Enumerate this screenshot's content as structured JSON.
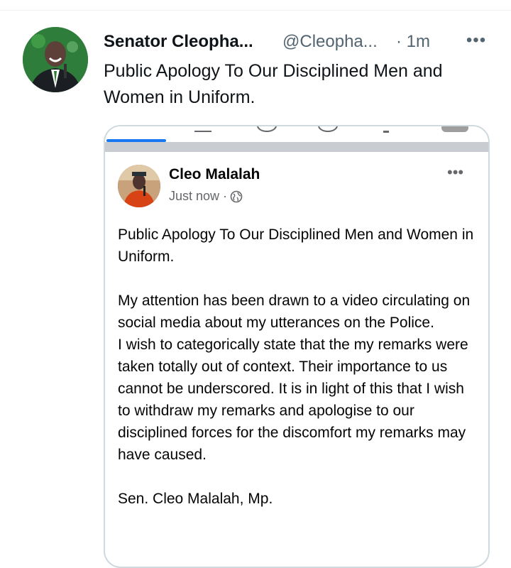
{
  "tweet": {
    "author_name": "Senator Cleopha...",
    "author_handle": "@Cleopha...",
    "time": "· 1m",
    "more_label": "•••",
    "text": "Public Apology To Our Disciplined Men and Women in Uniform.",
    "avatar_icon": "profile-photo"
  },
  "fb_post": {
    "name": "Cleo Malalah",
    "time": "Just now ·",
    "privacy_icon": "globe-icon",
    "more_label": "•••",
    "title": "Public Apology To Our Disciplined Men and Women in Uniform.",
    "paragraph1": "My attention has been drawn to a video circulating on social media about my utterances on the Police.",
    "paragraph2": "I wish to categorically state that the my remarks were taken totally out of context. Their importance to us cannot be underscored. It is in light of this that I wish to withdraw my remarks and apologise to our disciplined forces for the discomfort my remarks may have caused.",
    "signature": "Sen. Cleo Malalah, Mp."
  },
  "colors": {
    "text_primary": "#0f1419",
    "text_secondary": "#536471",
    "facebook_blue": "#1877f2"
  }
}
